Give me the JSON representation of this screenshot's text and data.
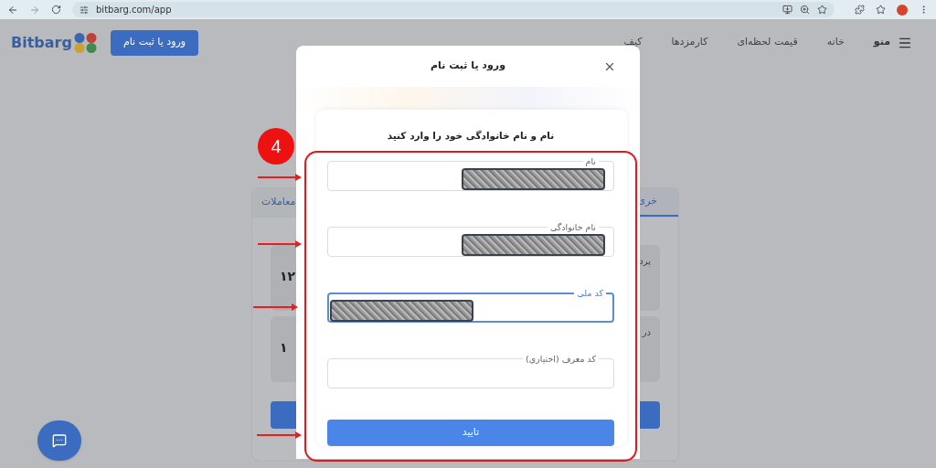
{
  "browser": {
    "url": "bitbarg.com/app"
  },
  "header": {
    "logo": "Bitbarg",
    "login_button": "ورود یا ثبت نام",
    "menu_label": "منو",
    "nav": [
      "خانه",
      "قیمت لحظه‌ای",
      "کارمزدها",
      "کیف"
    ]
  },
  "background_card": {
    "tabs": [
      {
        "label": "خری",
        "selected": true
      },
      {
        "label": "معاملات",
        "selected": false
      }
    ],
    "tiles": [
      {
        "label": "پرد",
        "value": "۱۲"
      },
      {
        "label": "در",
        "value": "۱"
      }
    ]
  },
  "modal": {
    "title": "ورود یا ثبت نام",
    "prompt": "نام و نام خانوادگی خود را وارد کنید",
    "fields": [
      {
        "label": "نام",
        "redacted": true,
        "kind": "text",
        "focused": false
      },
      {
        "label": "نام خانوادگی",
        "redacted": true,
        "kind": "text",
        "focused": false
      },
      {
        "label": "کد ملی",
        "redacted": true,
        "kind": "number",
        "focused": true
      },
      {
        "label": "کد معرف (اختیاری)",
        "redacted": false,
        "kind": "text",
        "focused": false
      }
    ],
    "submit": "تایید"
  },
  "annotation": {
    "step": "4"
  }
}
